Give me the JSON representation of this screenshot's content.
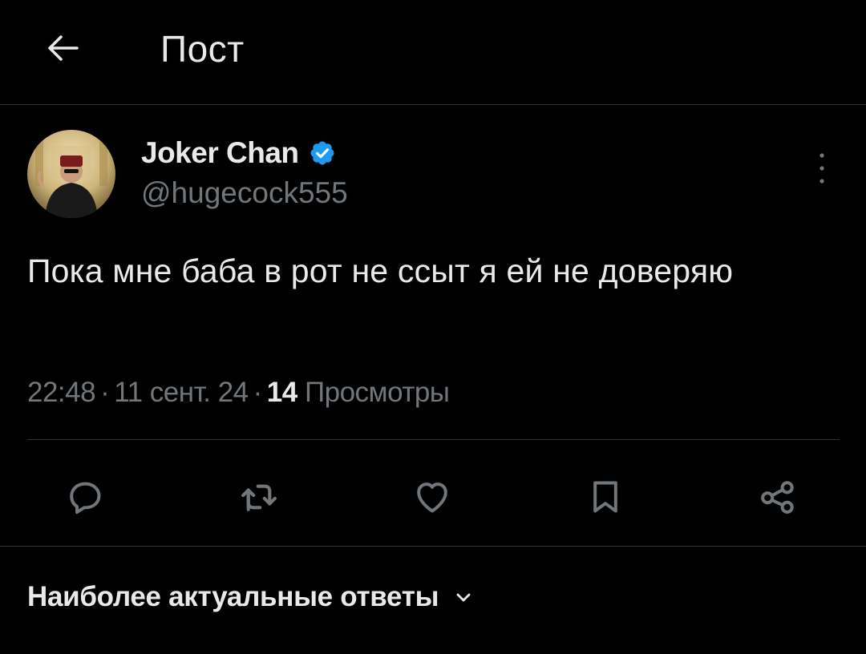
{
  "header": {
    "title": "Пост",
    "back_icon": "arrow-left-icon"
  },
  "author": {
    "display_name": "Joker Chan",
    "handle": "@hugecock555",
    "verified": true,
    "verified_color": "#1d9bf0",
    "more_icon": "more-vertical-icon"
  },
  "post": {
    "text": "Пока мне баба в рот не ссыт я ей не доверяю",
    "time": "22:48",
    "date": "11 сент. 24",
    "separator": "·",
    "views_count": "14",
    "views_label": "Просмотры"
  },
  "actions": [
    {
      "name": "reply",
      "icon": "reply-icon"
    },
    {
      "name": "repost",
      "icon": "repost-icon"
    },
    {
      "name": "like",
      "icon": "heart-icon"
    },
    {
      "name": "bookmark",
      "icon": "bookmark-icon"
    },
    {
      "name": "share",
      "icon": "share-icon"
    }
  ],
  "replies": {
    "sort_label": "Наиболее актуальные ответы",
    "icon": "chevron-down-icon"
  },
  "colors": {
    "background": "#000000",
    "text": "#e7e9ea",
    "secondary": "#71767b",
    "divider": "#2f3336",
    "accent": "#1d9bf0"
  }
}
